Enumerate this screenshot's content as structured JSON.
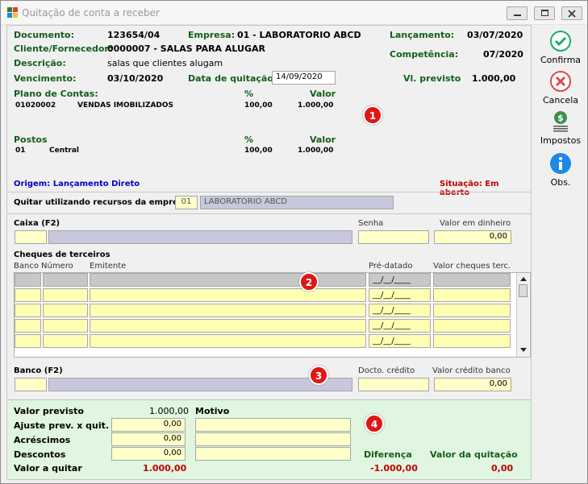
{
  "window": {
    "title": "Quitação de conta a receber"
  },
  "header": {
    "documento_label": "Documento:",
    "documento": "123654/04",
    "empresa_label": "Empresa:",
    "empresa": "01 - LABORATORIO ABCD",
    "lancamento_label": "Lançamento:",
    "lancamento": "03/07/2020",
    "cliente_label": "Cliente/Fornecedor:",
    "cliente": "0000007 - SALAS PARA ALUGAR",
    "competencia_label": "Competência:",
    "competencia": "07/2020",
    "descricao_label": "Descrição:",
    "descricao": "salas que clientes alugam",
    "vencimento_label": "Vencimento:",
    "vencimento": "03/10/2020",
    "data_quitacao_label": "Data de quitação:",
    "data_quitacao": "14/09/2020",
    "vl_previsto_label": "Vl. previsto",
    "vl_previsto": "1.000,00"
  },
  "plano": {
    "label": "Plano de Contas:",
    "pct_header": "%",
    "valor_header": "Valor",
    "code": "01020002",
    "name": "VENDAS IMOBILIZADOS",
    "pct": "100,00",
    "valor": "1.000,00"
  },
  "postos": {
    "label": "Postos",
    "pct_header": "%",
    "valor_header": "Valor",
    "code": "01",
    "name": "Central",
    "pct": "100,00",
    "valor": "1.000,00"
  },
  "origem": "Origem: Lançamento Direto",
  "situacao": "Situação: Em aberto",
  "quitar": {
    "label": "Quitar utilizando recursos da empresa:",
    "code": "01",
    "name": "LABORATORIO ABCD"
  },
  "caixa": {
    "label": "Caixa (F2)",
    "senha_label": "Senha",
    "valor_dinheiro_label": "Valor em dinheiro",
    "valor_dinheiro": "0,00"
  },
  "cheques": {
    "label": "Cheques de terceiros",
    "col_banco": "Banco",
    "col_numero": "Número",
    "col_emitente": "Emitente",
    "col_predatado": "Pré-datado",
    "col_valor": "Valor cheques terc.",
    "date_mask": "__/__/____"
  },
  "banco": {
    "label": "Banco (F2)",
    "docto_label": "Docto. crédito",
    "valor_credito_label": "Valor crédito banco",
    "valor_credito": "0,00"
  },
  "totals": {
    "valor_previsto_label": "Valor previsto",
    "valor_previsto": "1.000,00",
    "motivo_label": "Motivo",
    "ajuste_label": "Ajuste prev. x quit.",
    "ajuste": "0,00",
    "acrescimos_label": "Acréscimos",
    "acrescimos": "0,00",
    "descontos_label": "Descontos",
    "descontos": "0,00",
    "valor_quitar_label": "Valor a quitar",
    "valor_quitar": "1.000,00",
    "diferenca_label": "Diferença",
    "diferenca": "-1.000,00",
    "valor_quitacao_label": "Valor da quitação",
    "valor_quitacao": "0,00"
  },
  "side": {
    "confirma": "Confirma",
    "cancela": "Cancela",
    "impostos": "Impostos",
    "obs": "Obs."
  },
  "badges": [
    "1",
    "2",
    "3",
    "4"
  ],
  "colors": {
    "label_green": "#145e1a",
    "field_yellow": "#ffffc8",
    "badge_red": "#e01616",
    "blue": "#0000c8",
    "red": "#c00000"
  }
}
